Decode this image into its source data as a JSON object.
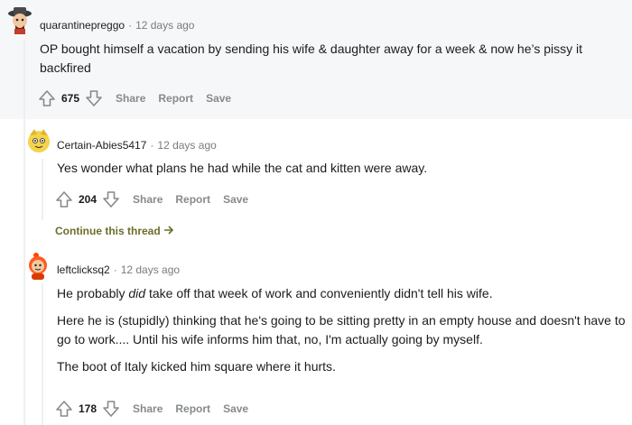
{
  "comments": [
    {
      "username": "quarantinepreggo",
      "time": "12 days ago",
      "paragraphs": [
        "OP bought himself a vacation by sending his wife & daughter away for a week & now he’s pissy it backfired"
      ],
      "votes": "675",
      "actions": [
        "Share",
        "Report",
        "Save"
      ],
      "avatar_icon": "avatar-hat-icon"
    },
    {
      "username": "Certain-Abies5417",
      "time": "12 days ago",
      "paragraphs": [
        "Yes wonder what plans he had while the cat and kitten were away."
      ],
      "votes": "204",
      "actions": [
        "Share",
        "Report",
        "Save"
      ],
      "continue_label": "Continue this thread",
      "avatar_icon": "avatar-yellow-icon"
    },
    {
      "username": "leftclicksq2",
      "time": "12 days ago",
      "paragraph1_pre": "He probably ",
      "paragraph1_em": "did",
      "paragraph1_post": " take off that week of work and conveniently didn't tell his wife.",
      "paragraph2": "Here he is (stupidly) thinking that he's going to be sitting pretty in an empty house and doesn't have to go to work.... Until his wife informs him that, no, I'm actually going by myself.",
      "paragraph3": "The boot of Italy kicked him square where it hurts.",
      "votes": "178",
      "actions": [
        "Share",
        "Report",
        "Save"
      ],
      "avatar_icon": "avatar-orange-icon"
    }
  ],
  "colors": {
    "meta": "#787c7e",
    "continue": "#6b6e2b",
    "highlight_bg": "#f6f7f8"
  }
}
